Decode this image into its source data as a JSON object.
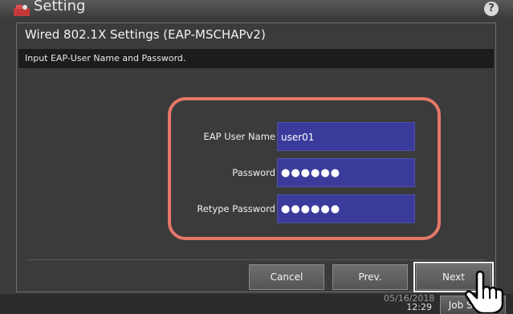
{
  "background": {
    "app_title": "Setting",
    "help_icon": "?",
    "date_partial": "05/16/2018",
    "time": "12:29",
    "job_status_label": "Job Status"
  },
  "dialog": {
    "title": "Wired 802.1X Settings (EAP-MSCHAPv2)",
    "instruction": "Input EAP-User Name and Password."
  },
  "fields": [
    {
      "label": "EAP User Name",
      "value": "user01"
    },
    {
      "label": "Password",
      "value": "●●●●●●"
    },
    {
      "label": "Retype Password",
      "value": "●●●●●●"
    }
  ],
  "buttons": {
    "cancel": "Cancel",
    "prev": "Prev.",
    "next": "Next"
  },
  "colors": {
    "highlight": "#e6786a",
    "input_bg": "#3b3b9c"
  }
}
